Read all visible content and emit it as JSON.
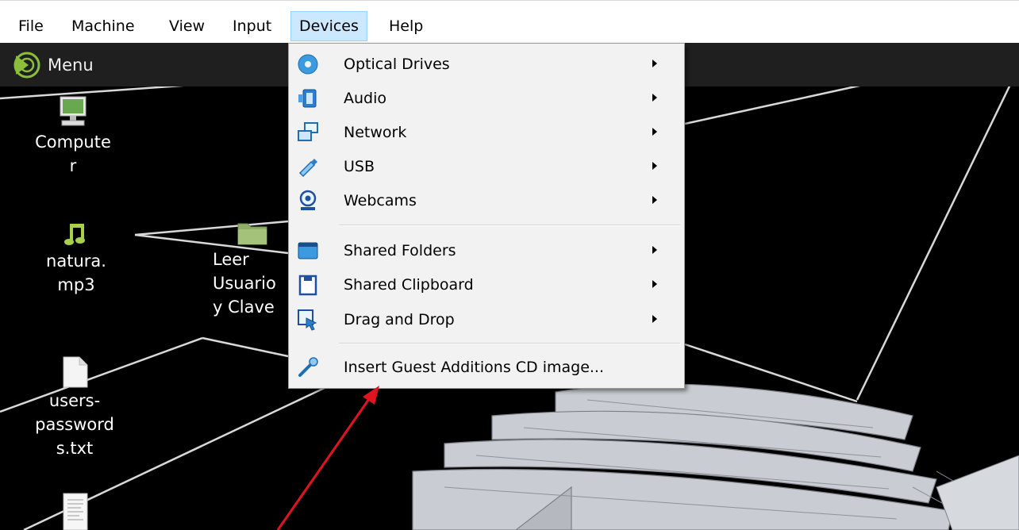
{
  "menubar": {
    "items": [
      {
        "label": "File"
      },
      {
        "label": "Machine"
      },
      {
        "label": "View"
      },
      {
        "label": "Input"
      },
      {
        "label": "Devices",
        "active": true
      },
      {
        "label": "Help"
      }
    ]
  },
  "guest_panel": {
    "menu_label": "Menu",
    "menu_icon": "mint-logo-icon"
  },
  "desktop_icons": [
    {
      "label": "Compute\nr",
      "icon": "computer-icon"
    },
    {
      "label": "natura.\nmp3",
      "icon": "music-note-icon"
    },
    {
      "label": "Leer\nUsuario\ny Clave",
      "icon": "folder-icon"
    },
    {
      "label": "users-\npassword\ns.txt",
      "icon": "text-file-icon"
    },
    {
      "label": "",
      "icon": "document-icon"
    }
  ],
  "devices_menu": {
    "items": [
      {
        "label": "Optical Drives",
        "icon": "optical-drive-icon",
        "submenu": true
      },
      {
        "label": "Audio",
        "icon": "audio-icon",
        "submenu": true
      },
      {
        "label": "Network",
        "icon": "network-icon",
        "submenu": true
      },
      {
        "label": "USB",
        "icon": "usb-icon",
        "submenu": true
      },
      {
        "label": "Webcams",
        "icon": "webcam-icon",
        "submenu": true
      },
      {
        "label": "Shared Folders",
        "icon": "shared-folder-icon",
        "submenu": true
      },
      {
        "label": "Shared Clipboard",
        "icon": "shared-clipboard-icon",
        "submenu": true
      },
      {
        "label": "Drag and Drop",
        "icon": "drag-and-drop-icon",
        "submenu": true
      },
      {
        "label": "Insert Guest Additions CD image...",
        "icon": "guest-additions-icon",
        "submenu": false
      }
    ]
  },
  "colors": {
    "menubar_bg": "#ffffff",
    "menubar_active": "#cce8ff",
    "menu_bg": "#f2f2f2",
    "desktop_bg": "#000000",
    "panel_bg": "#1f1f1f",
    "annotation_arrow": "#e0141e"
  }
}
